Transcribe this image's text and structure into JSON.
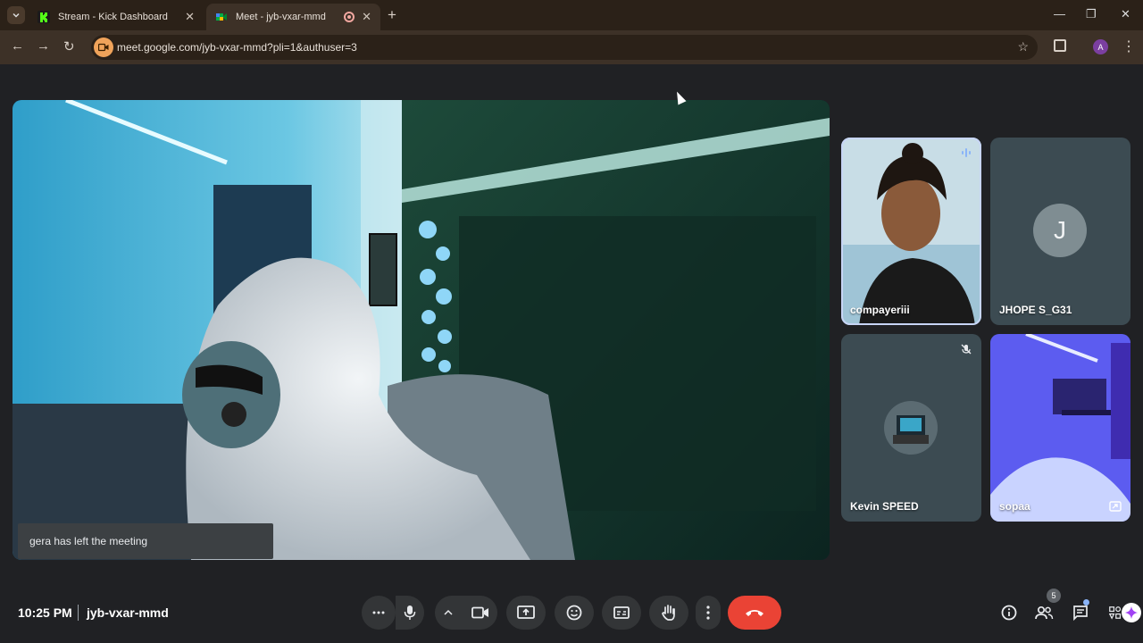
{
  "browser": {
    "tabs": [
      {
        "title": "Stream - Kick Dashboard",
        "active": false,
        "icon": "kick-logo-icon"
      },
      {
        "title": "Meet - jyb-vxar-mmd",
        "active": true,
        "icon": "meet-logo-icon",
        "recording": true
      }
    ],
    "url": "meet.google.com/jyb-vxar-mmd?pli=1&authuser=3",
    "profile_initial": "A"
  },
  "meeting": {
    "time": "10:25 PM",
    "code": "jyb-vxar-mmd",
    "toast": "gera has left the meeting",
    "participant_count": "5",
    "participants": [
      {
        "name": "compayeriii",
        "state": "speaking",
        "video": true
      },
      {
        "name": "JHOPE S_G31",
        "avatar_initial": "J",
        "video": false
      },
      {
        "name": "Kevin SPEED",
        "state": "muted",
        "video": false
      },
      {
        "name": "sopaa",
        "video": true,
        "badge": "pip-icon"
      }
    ]
  },
  "colors": {
    "end_call": "#ea4335",
    "control_bg": "#333537",
    "stage_bg": "#202124",
    "chrome_bg": "#2b2118",
    "toolbar_bg": "#3d3127"
  }
}
